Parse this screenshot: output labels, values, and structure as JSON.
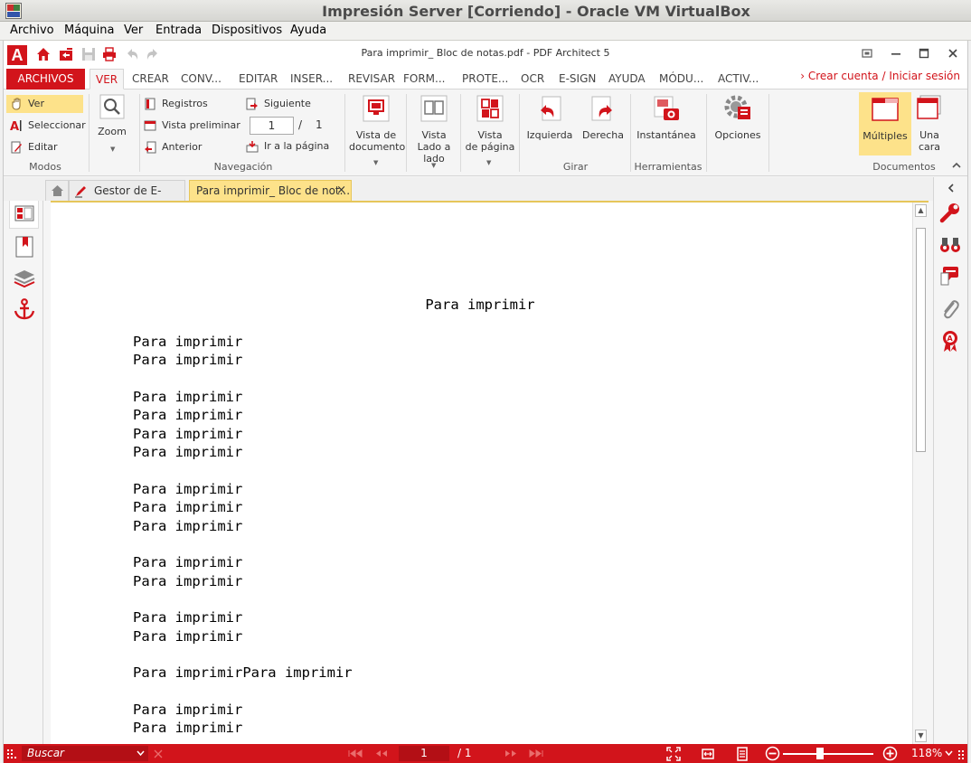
{
  "vbox": {
    "title": "Impresión Server [Corriendo] - Oracle VM VirtualBox",
    "menu": [
      "Archivo",
      "Máquina",
      "Ver",
      "Entrada",
      "Dispositivos",
      "Ayuda"
    ]
  },
  "app": {
    "logo": "A",
    "doc_title": "Para imprimir_ Bloc de notas.pdf   -   PDF Architect 5",
    "account_link": "Crear cuenta / Iniciar sesión",
    "account_arrow": "›"
  },
  "tabs": {
    "archivos": "ARCHIVOS",
    "items": [
      "VER",
      "CREAR",
      "CONV...",
      "EDITAR",
      "INSER...",
      "REVISAR",
      "FORM...",
      "PROTE...",
      "OCR",
      "E-SIGN",
      "AYUDA",
      "MÓDU...",
      "ACTIV..."
    ]
  },
  "ribbon": {
    "modos": {
      "label": "Modos",
      "ver": "Ver",
      "seleccionar": "Seleccionar",
      "editar": "Editar"
    },
    "zoom": {
      "label": "Zoom"
    },
    "navegacion": {
      "label": "Navegación",
      "registros": "Registros",
      "vista_preliminar": "Vista preliminar",
      "anterior": "Anterior",
      "siguiente": "Siguiente",
      "page_value": "1",
      "page_sep": "/",
      "page_total": "1",
      "ir_pagina": "Ir a la página"
    },
    "vistas": {
      "documento": [
        "Vista de",
        "documento"
      ],
      "lado": [
        "Vista",
        "Lado a",
        "lado"
      ],
      "pagina": [
        "Vista",
        "de página"
      ]
    },
    "girar": {
      "label": "Girar",
      "izquierda": "Izquierda",
      "derecha": "Derecha"
    },
    "herramientas": {
      "label": "Herramientas",
      "instantanea": "Instantánea",
      "opciones": "Opciones"
    },
    "documentos": {
      "label": "Documentos",
      "multiples": "Múltiples",
      "una_cara": [
        "Una",
        "cara"
      ]
    }
  },
  "doc_tabs": [
    {
      "label": "Gestor de E-Sign"
    },
    {
      "label": "Para imprimir_ Bloc de not...",
      "close": "×"
    }
  ],
  "document": {
    "heading": "Para imprimir",
    "lines": [
      "Para imprimir",
      "Para imprimir",
      "",
      "Para imprimir",
      "Para imprimir",
      "Para imprimir",
      "Para imprimir",
      "",
      "Para imprimir",
      "Para imprimir",
      "Para imprimir",
      "",
      "Para imprimir",
      "Para imprimir",
      "",
      "Para imprimir",
      "Para imprimir",
      "",
      "Para imprimirPara imprimir",
      "",
      "Para imprimir",
      "Para imprimir"
    ]
  },
  "status": {
    "search_placeholder": "Buscar",
    "page_current": "1",
    "page_total": "/ 1",
    "zoom": "118%"
  },
  "colors": {
    "accent": "#d2141b",
    "highlight": "#fde28a"
  }
}
